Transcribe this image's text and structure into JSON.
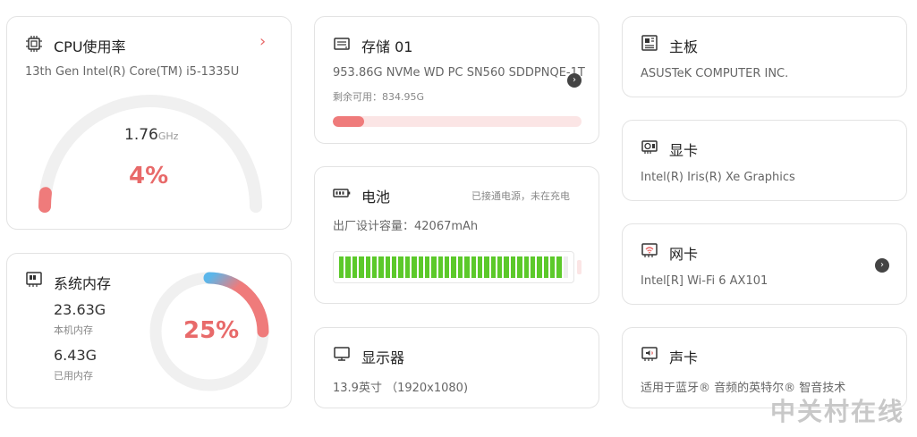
{
  "cpu": {
    "title": "CPU使用率",
    "model": "13th Gen Intel(R) Core(TM) i5-1335U",
    "freq_value": "1.76",
    "freq_unit": "GHz",
    "usage_label": "4%",
    "usage": 0.04
  },
  "memory": {
    "title": "系统内存",
    "total_value": "23.63G",
    "total_label": "本机内存",
    "used_value": "6.43G",
    "used_label": "已用内存",
    "usage_label": "25%",
    "usage": 0.25
  },
  "storage": {
    "title": "存储 01",
    "device": "953.86G  NVMe WD PC SN560 SDDPNQE-1T",
    "free": "剩余可用：834.95G",
    "used_fraction": 0.125
  },
  "battery": {
    "title": "电池",
    "status": "已接通电源，未在充电",
    "capacity": "出厂设计容量：42067mAh",
    "segments": 35,
    "level": 0.97
  },
  "display": {
    "title": "显示器",
    "spec": "13.9英寸 （1920x1080)"
  },
  "motherboard": {
    "title": "主板",
    "vendor": "ASUSTeK COMPUTER INC."
  },
  "gpu": {
    "title": "显卡",
    "model": "Intel(R) Iris(R) Xe Graphics"
  },
  "network": {
    "title": "网卡",
    "model": "Intel[R] Wi-Fi 6 AX101"
  },
  "audio": {
    "title": "声卡",
    "model": "适用于蓝牙® 音频的英特尔® 智音技术"
  },
  "watermark": "中关村在线",
  "colors": {
    "accent": "#ef7b7b",
    "battery_green": "#5cc92a",
    "track": "#f0f0f0",
    "mem_start": "#5bb6ea"
  },
  "icons": {
    "cpu": "cpu-chip-icon",
    "memory": "memory-module-icon",
    "storage": "storage-drive-icon",
    "battery": "battery-icon",
    "display": "monitor-icon",
    "motherboard": "motherboard-icon",
    "gpu": "graphics-card-icon",
    "network": "wifi-card-icon",
    "audio": "sound-card-icon"
  }
}
